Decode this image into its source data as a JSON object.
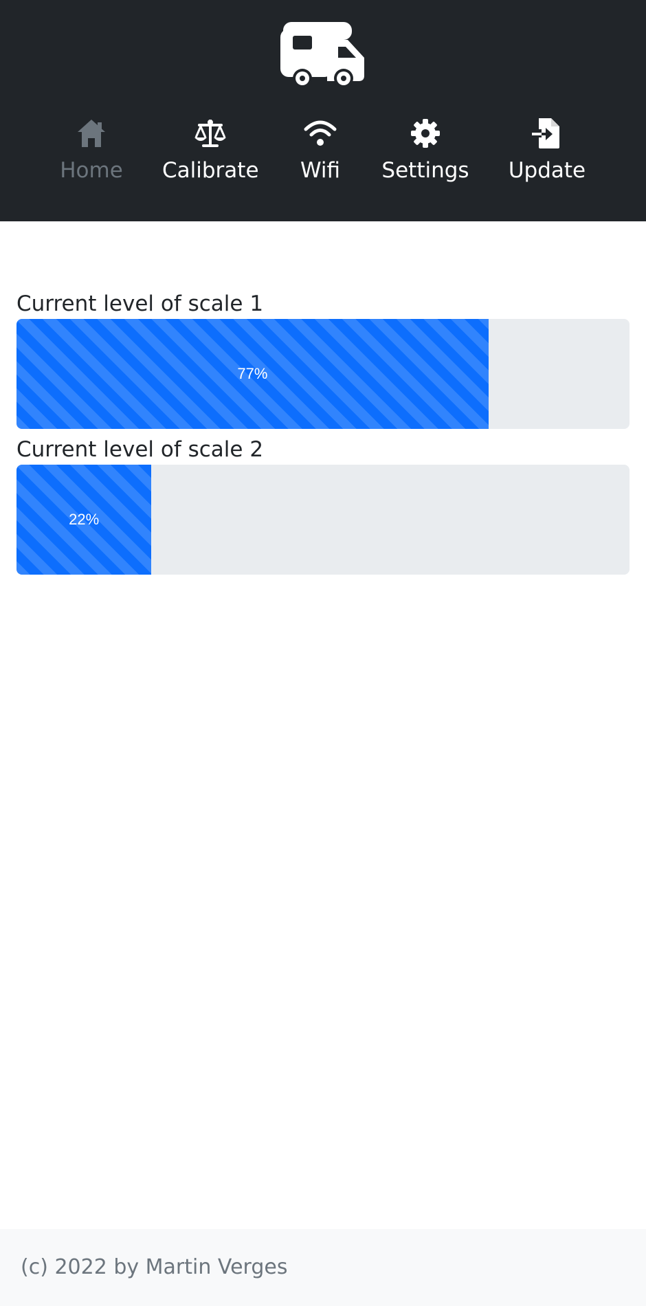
{
  "header": {
    "logo_icon": "camper-van-icon",
    "background_color": "#212529"
  },
  "nav": {
    "items": [
      {
        "label": "Home",
        "icon": "house-icon",
        "active": true
      },
      {
        "label": "Calibrate",
        "icon": "scale-balance-icon",
        "active": false
      },
      {
        "label": "Wifi",
        "icon": "wifi-icon",
        "active": false
      },
      {
        "label": "Settings",
        "icon": "gear-icon",
        "active": false
      },
      {
        "label": "Update",
        "icon": "file-import-icon",
        "active": false
      }
    ],
    "active_color": "#6c757d",
    "inactive_color": "#ffffff"
  },
  "scales": [
    {
      "label": "Current level of scale 1",
      "level_percent": 77,
      "level_text": "77%"
    },
    {
      "label": "Current level of scale 2",
      "level_percent": 22,
      "level_text": "22%"
    }
  ],
  "progress_colors": {
    "bar": "#0d6efd",
    "track": "#e9ecef"
  },
  "footer": {
    "text": "(c) 2022 by Martin Verges"
  }
}
